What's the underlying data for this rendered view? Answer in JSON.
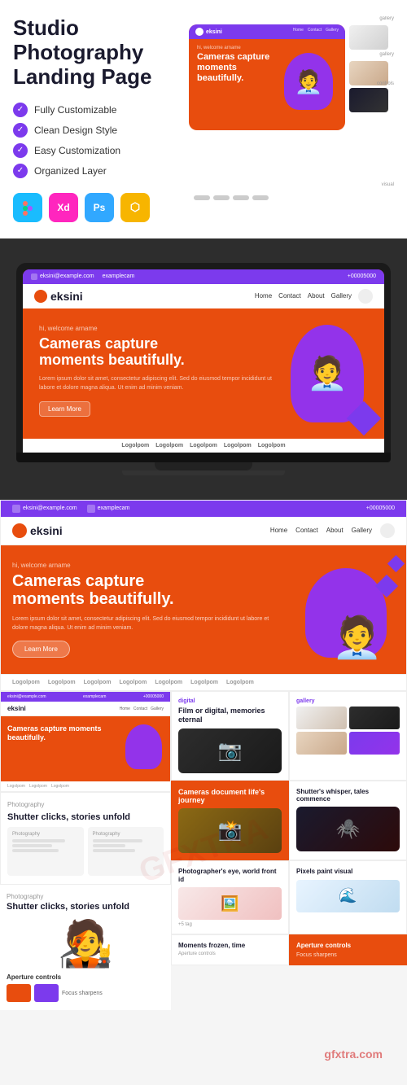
{
  "page": {
    "title": "Studio Photography Landing Page",
    "watermark": "GFXTRA"
  },
  "header": {
    "title_line1": "Studio",
    "title_line2": "Photography",
    "title_line3": "Landing Page"
  },
  "features": {
    "items": [
      {
        "label": "Fully Customizable"
      },
      {
        "label": "Clean Design Style"
      },
      {
        "label": "Easy Customization"
      },
      {
        "label": "Organized Layer"
      }
    ]
  },
  "tools": [
    {
      "name": "Figma",
      "abbr": "Fi",
      "class": "tool-figma"
    },
    {
      "name": "Adobe XD",
      "abbr": "Xd",
      "class": "tool-xd"
    },
    {
      "name": "Photoshop",
      "abbr": "Ps",
      "class": "tool-ps"
    },
    {
      "name": "Sketch",
      "abbr": "Sk",
      "class": "tool-sketch"
    }
  ],
  "site": {
    "logo": "eksini",
    "contact_email": "eksini@example.com",
    "contact_cam": "examplecam",
    "contact_phone": "+00005000",
    "nav_items": [
      "Home",
      "Contact",
      "About",
      "Gallery"
    ],
    "welcome_text": "hi, welcome arname",
    "headline_line1": "Cameras capture",
    "headline_line2": "moments beautifully.",
    "body_text": "Lorem ipsum dolor sit amet, consectetur adipiscing elit. Sed do eiusmod tempor incididunt ut labore et dolore magna aliqua. Ut enim ad minim veniam.",
    "cta_button": "Learn More"
  },
  "brand_logos": [
    "Logolpom",
    "Logolpom",
    "Logolpom",
    "Logolpom",
    "Logolpom"
  ],
  "gallery_section": {
    "label": "gallery",
    "title": "Cameras document life's journey"
  },
  "digital_section": {
    "label": "digital",
    "title": "Film or digital, memories eternal"
  },
  "shutter_section": {
    "label": "",
    "title": "Shutter clicks, stories unfold"
  },
  "aperture_section": {
    "label": "Aperture controls"
  },
  "focus_section": {
    "label": "Focus sharpens"
  },
  "moments_section": {
    "title": "Moments frozen, time"
  },
  "whisper_section": {
    "title": "Shutter's whisper, tales commence"
  },
  "pixels_section": {
    "title": "Pixels paint visual"
  },
  "photographer_section": {
    "title": "Photographer's eye, world front id"
  }
}
